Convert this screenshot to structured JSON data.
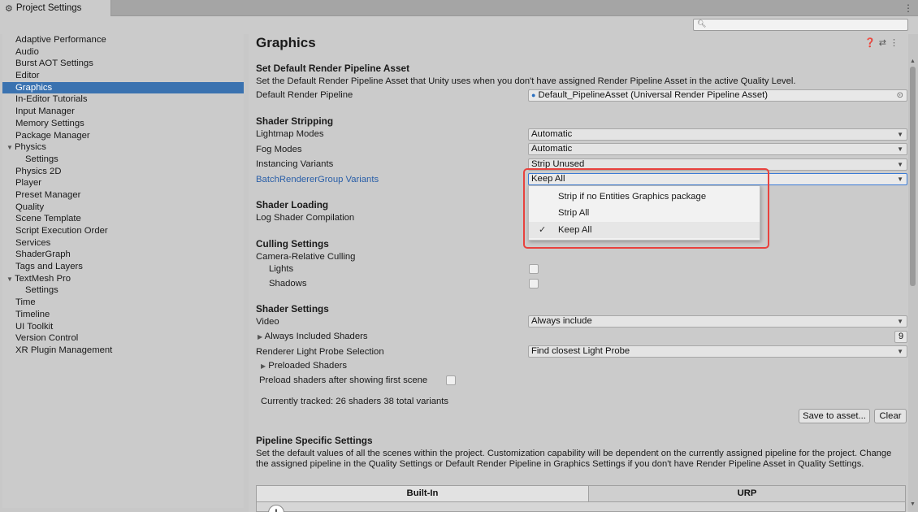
{
  "window": {
    "tab_title": "Project Settings",
    "menu_glyph": "⋮",
    "search_placeholder": ""
  },
  "sidebar": {
    "items": [
      {
        "label": "Adaptive Performance",
        "sub": false
      },
      {
        "label": "Audio",
        "sub": false
      },
      {
        "label": "Burst AOT Settings",
        "sub": false
      },
      {
        "label": "Editor",
        "sub": false
      },
      {
        "label": "Graphics",
        "sub": false,
        "selected": true
      },
      {
        "label": "In-Editor Tutorials",
        "sub": false
      },
      {
        "label": "Input Manager",
        "sub": false
      },
      {
        "label": "Memory Settings",
        "sub": false
      },
      {
        "label": "Package Manager",
        "sub": false
      },
      {
        "label": "Physics",
        "sub": false,
        "foldout": true
      },
      {
        "label": "Settings",
        "sub": true
      },
      {
        "label": "Physics 2D",
        "sub": false
      },
      {
        "label": "Player",
        "sub": false
      },
      {
        "label": "Preset Manager",
        "sub": false
      },
      {
        "label": "Quality",
        "sub": false
      },
      {
        "label": "Scene Template",
        "sub": false
      },
      {
        "label": "Script Execution Order",
        "sub": false
      },
      {
        "label": "Services",
        "sub": false
      },
      {
        "label": "ShaderGraph",
        "sub": false
      },
      {
        "label": "Tags and Layers",
        "sub": false
      },
      {
        "label": "TextMesh Pro",
        "sub": false,
        "foldout": true
      },
      {
        "label": "Settings",
        "sub": true
      },
      {
        "label": "Time",
        "sub": false
      },
      {
        "label": "Timeline",
        "sub": false
      },
      {
        "label": "UI Toolkit",
        "sub": false
      },
      {
        "label": "Version Control",
        "sub": false
      },
      {
        "label": "XR Plugin Management",
        "sub": false
      }
    ]
  },
  "main": {
    "title": "Graphics",
    "render_pipeline": {
      "heading": "Set Default Render Pipeline Asset",
      "description": "Set the Default Render Pipeline Asset that Unity uses when you don't have assigned Render Pipeline Asset in the active Quality Level.",
      "label": "Default Render Pipeline",
      "value": "Default_PipelineAsset (Universal Render Pipeline Asset)"
    },
    "shader_stripping": {
      "heading": "Shader Stripping",
      "lightmap_label": "Lightmap Modes",
      "lightmap_value": "Automatic",
      "fog_label": "Fog Modes",
      "fog_value": "Automatic",
      "instancing_label": "Instancing Variants",
      "instancing_value": "Strip Unused",
      "brg_label": "BatchRendererGroup Variants",
      "brg_value": "Keep All"
    },
    "shader_loading": {
      "heading": "Shader Loading",
      "log_label": "Log Shader Compilation"
    },
    "culling": {
      "heading": "Culling Settings",
      "camera_label": "Camera-Relative Culling",
      "lights_label": "Lights",
      "shadows_label": "Shadows"
    },
    "shader_settings": {
      "heading": "Shader Settings",
      "video_label": "Video",
      "video_value": "Always include",
      "always_included_label": "Always Included Shaders",
      "always_included_count": "9",
      "light_probe_label": "Renderer Light Probe Selection",
      "light_probe_value": "Find closest Light Probe",
      "preloaded_label": "Preloaded Shaders",
      "preload_after_label": "Preload shaders after showing first scene",
      "tracked_text": "Currently tracked: 26 shaders 38 total variants",
      "save_button": "Save to asset...",
      "clear_button": "Clear"
    },
    "pipeline_specific": {
      "heading": "Pipeline Specific Settings",
      "description": "Set the default values of all the scenes within the project. Customization capability will be dependent on the currently assigned pipeline for the project. Change the assigned pipeline in the Quality Settings or Default Render Pipeline in Graphics Settings if you don't have Render Pipeline Asset in Quality Settings.",
      "tab_builtin": "Built-In",
      "tab_urp": "URP"
    }
  },
  "dropdown_menu": {
    "options": [
      {
        "label": "Strip if no Entities Graphics package",
        "checked": false
      },
      {
        "label": "Strip All",
        "checked": false
      },
      {
        "label": "Keep All",
        "checked": true
      }
    ],
    "check_glyph": "✓"
  },
  "colors": {
    "selection": "#3a72b0",
    "highlight_box": "#e8423e",
    "link_label": "#2a5fa8"
  }
}
